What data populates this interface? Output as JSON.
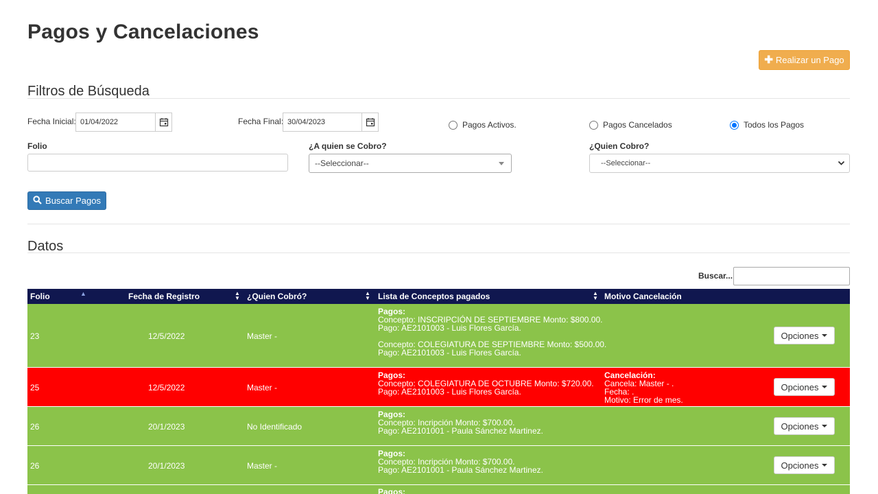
{
  "page": {
    "title": "Pagos y Cancelaciones"
  },
  "actions": {
    "realizar_pago": "Realizar un Pago",
    "buscar": "Buscar Pagos"
  },
  "filters": {
    "title": "Filtros de Búsqueda",
    "fecha_inicial_label": "Fecha Inicial:",
    "fecha_inicial": "01/04/2022",
    "fecha_final_label": "Fecha Final:",
    "fecha_final": "30/04/2023",
    "radios": [
      {
        "label": "Pagos Activos.",
        "checked": false
      },
      {
        "label": "Pagos Cancelados",
        "checked": false
      },
      {
        "label": "Todos los Pagos",
        "checked": true
      }
    ],
    "folio_label": "Folio",
    "folio_value": "",
    "a_quien_label": "¿A quien se Cobro?",
    "a_quien_value": "--Seleccionar--",
    "quien_label": "¿Quien Cobro?",
    "quien_value": "--Seleccionar--"
  },
  "datos": {
    "title": "Datos",
    "search_label": "Buscar...",
    "search_value": "",
    "columns": [
      "Folio",
      "Fecha de Registro",
      "¿Quien Cobró?",
      "Lista de Conceptos pagados",
      "Motivo Cancelación"
    ],
    "options_label": "Opciones",
    "rows": [
      {
        "status": "green",
        "folio": "23",
        "fecha": "12/5/2022",
        "quien": "Master -",
        "pagos_title": "Pagos:",
        "lines": [
          "Concepto: INSCRIPCIÓN DE SEPTIEMBRE Monto: $800.00.",
          "Pago: AE2101003 - Luis Flores García.",
          "",
          "Concepto: COLEGIATURA DE SEPTIEMBRE Monto: $500.00.",
          "Pago: AE2101003 - Luis Flores García."
        ],
        "cancel": []
      },
      {
        "status": "red",
        "folio": "25",
        "fecha": "12/5/2022",
        "quien": "Master -",
        "pagos_title": "Pagos:",
        "lines": [
          "Concepto: COLEGIATURA DE OCTUBRE Monto: $720.00.",
          "Pago: AE2101003 - Luis Flores García."
        ],
        "cancel_title": "Cancelación:",
        "cancel": [
          "Cancela: Master - .",
          "Fecha: .",
          "Motivo: Error de mes."
        ]
      },
      {
        "status": "green",
        "folio": "26",
        "fecha": "20/1/2023",
        "quien": "No Identificado",
        "pagos_title": "Pagos:",
        "lines": [
          "Concepto: Incripción Monto: $700.00.",
          "Pago: AE2101001 - Paula Sánchez Martinez."
        ],
        "cancel": []
      },
      {
        "status": "green",
        "folio": "26",
        "fecha": "20/1/2023",
        "quien": "Master -",
        "pagos_title": "Pagos:",
        "lines": [
          "Concepto: Incripción Monto: $700.00.",
          "Pago: AE2101001 - Paula Sánchez Martinez."
        ],
        "cancel": []
      },
      {
        "status": "green",
        "folio": "",
        "fecha": "",
        "quien": "",
        "pagos_title": "Pagos:",
        "lines": [],
        "cancel": []
      }
    ]
  },
  "colors": {
    "header_bg": "#10174f",
    "active_row": "#8bc34a",
    "cancelled_row": "#ff0000",
    "primary": "#337ab7",
    "warning": "#f0ad4e"
  }
}
